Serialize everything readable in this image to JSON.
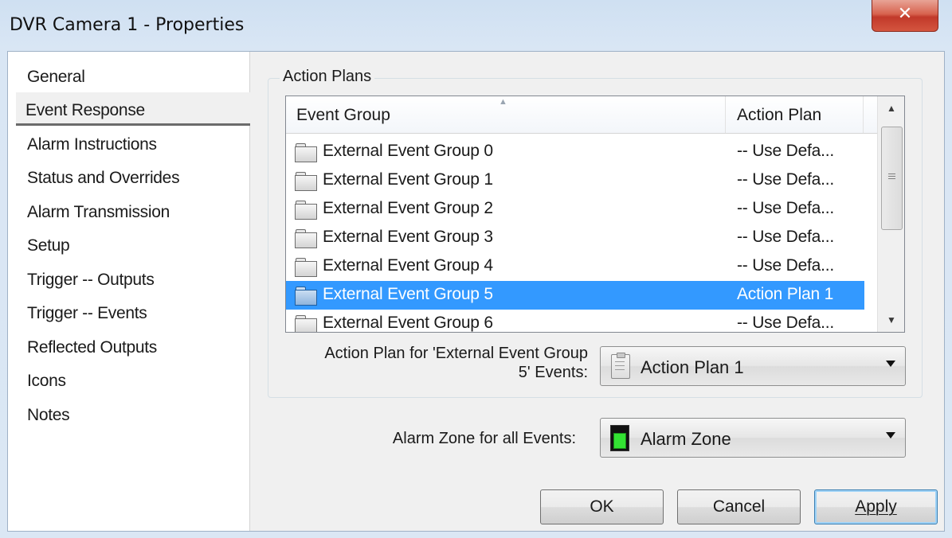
{
  "window": {
    "title": "DVR Camera 1 - Properties",
    "close_glyph": "✕"
  },
  "nav": {
    "items": [
      {
        "label": "General"
      },
      {
        "label": "Event Response"
      },
      {
        "label": "Alarm Instructions"
      },
      {
        "label": "Status and Overrides"
      },
      {
        "label": "Alarm Transmission"
      },
      {
        "label": "Setup"
      },
      {
        "label": "Trigger -- Outputs"
      },
      {
        "label": "Trigger -- Events"
      },
      {
        "label": "Reflected Outputs"
      },
      {
        "label": "Icons"
      },
      {
        "label": "Notes"
      }
    ],
    "selected": "Event Response"
  },
  "action_plans": {
    "group_title": "Action Plans",
    "columns": {
      "event_group": "Event Group",
      "action_plan": "Action Plan"
    },
    "rows": [
      {
        "name": "External Event Group 0",
        "plan": "-- Use Defa..."
      },
      {
        "name": "External Event Group 1",
        "plan": "-- Use Defa..."
      },
      {
        "name": "External Event Group 2",
        "plan": "-- Use Defa..."
      },
      {
        "name": "External Event Group 3",
        "plan": "-- Use Defa..."
      },
      {
        "name": "External Event Group 4",
        "plan": "-- Use Defa..."
      },
      {
        "name": "External Event Group 5",
        "plan": "Action Plan 1"
      },
      {
        "name": "External Event Group 6",
        "plan": "-- Use Defa..."
      }
    ],
    "selected_row": "External Event Group 5",
    "plan_label_line1": "Action Plan for 'External Event Group",
    "plan_label_line2": "5' Events:",
    "plan_value": "Action Plan 1"
  },
  "alarm_zone": {
    "label": "Alarm Zone for all Events:",
    "value": "Alarm Zone"
  },
  "buttons": {
    "ok": "OK",
    "cancel": "Cancel",
    "apply": "Apply"
  },
  "colors": {
    "selection": "#3399ff",
    "zone_green": "#33e233",
    "close_red": "#c1392a"
  },
  "icons": [
    "folder-icon",
    "action-plan-icon",
    "alarm-zone-icon",
    "close-icon",
    "dropdown-arrow-icon"
  ]
}
